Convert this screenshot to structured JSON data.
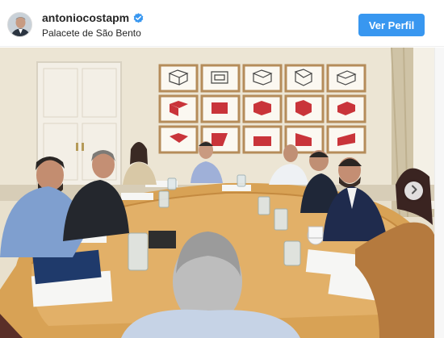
{
  "post": {
    "username": "antoniocostapm",
    "location": "Palacete de São Bento",
    "follow_label": "Ver Perfil",
    "verified": true
  },
  "icons": {
    "verified": "verified-badge-icon",
    "next": "chevron-right-icon"
  },
  "colors": {
    "button": "#3897f0",
    "verified": "#3897f0",
    "wall": "#e9e1cf",
    "table": "#d9a35a"
  }
}
